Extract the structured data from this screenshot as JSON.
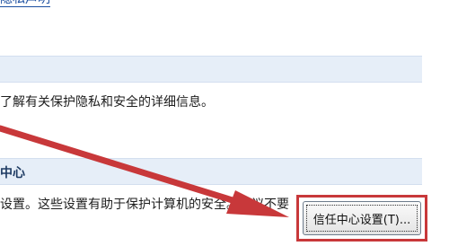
{
  "top_link": {
    "label": "隐私声明"
  },
  "privacy_section": {
    "description": "了解有关保护隐私和安全的详细信息。"
  },
  "trust_center_section": {
    "title": "中心",
    "description": "设置。这些设置有助于保护计算机的安全。建议不要",
    "button_label": "信任中心设置(T)..."
  },
  "colors": {
    "annotation_red": "#c8383a",
    "section_bar_bg": "#e6eef8",
    "link_blue": "#1c4fa0"
  }
}
